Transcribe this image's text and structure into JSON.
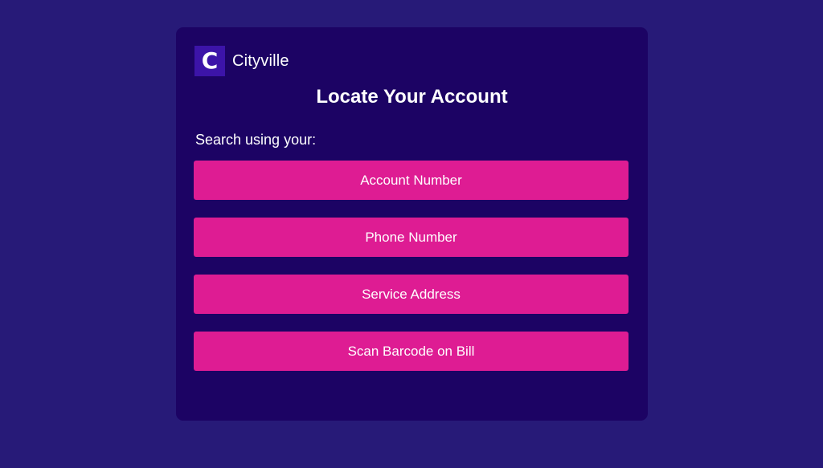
{
  "brand": {
    "logo_letter": "C",
    "name": "Cityville"
  },
  "page": {
    "title": "Locate Your Account",
    "prompt": "Search using your:"
  },
  "options": [
    {
      "label": "Account Number"
    },
    {
      "label": "Phone Number"
    },
    {
      "label": "Service Address"
    },
    {
      "label": "Scan Barcode on Bill"
    }
  ],
  "colors": {
    "page_background": "#271a78",
    "card_background": "#1c0364",
    "logo_background": "#3c14a8",
    "button_background": "#de1c93",
    "text": "#ffffff"
  }
}
